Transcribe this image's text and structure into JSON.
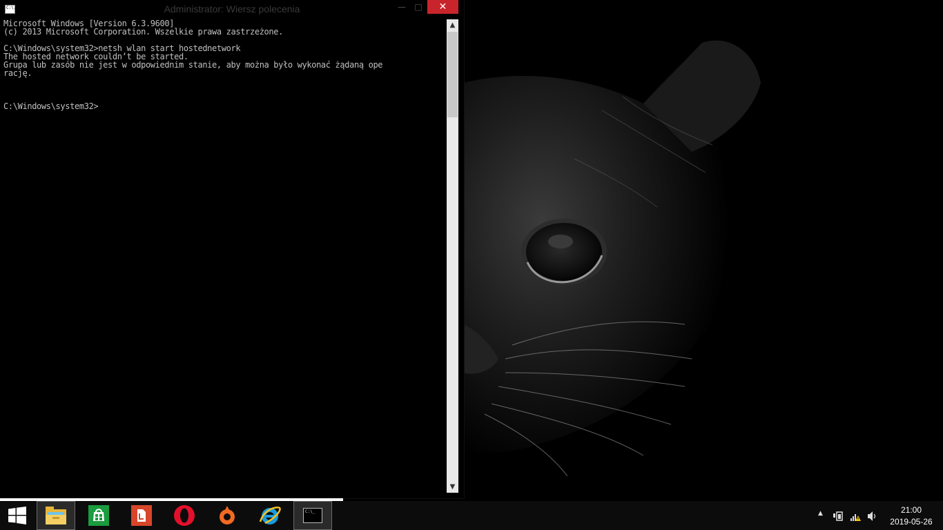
{
  "window": {
    "title": "Administrator: Wiersz polecenia",
    "icon_label": "C:\\.",
    "minimize_glyph": "—",
    "maximize_glyph": "□",
    "close_glyph": "✕"
  },
  "console": {
    "lines": [
      "Microsoft Windows [Version 6.3.9600]",
      "(c) 2013 Microsoft Corporation. Wszelkie prawa zastrzeżone.",
      "",
      "C:\\Windows\\system32>netsh wlan start hostednetwork",
      "The hosted network couldn’t be started.",
      "Grupa lub zasób nie jest w odpowiednim stanie, aby można było wykonać żądaną ope",
      "rację.",
      "",
      "",
      "",
      "C:\\Windows\\system32>"
    ]
  },
  "scrollbar": {
    "up_glyph": "▲",
    "down_glyph": "▼"
  },
  "taskbar": {
    "start_icon": "windows-logo-icon",
    "apps": [
      {
        "name": "file-explorer-icon",
        "active": false
      },
      {
        "name": "store-icon",
        "active": false
      },
      {
        "name": "acrobat-icon",
        "active": false
      },
      {
        "name": "opera-icon",
        "active": false
      },
      {
        "name": "origin-icon",
        "active": false
      },
      {
        "name": "internet-explorer-icon",
        "active": false
      },
      {
        "name": "command-prompt-icon",
        "active": true
      }
    ],
    "cmd_icon_label": "C:\\_",
    "tray": {
      "overflow_glyph": "▲",
      "time": "21:00",
      "date": "2019-05-26"
    }
  },
  "colors": {
    "console_text": "#c0c0c0",
    "close_button": "#c7252b",
    "taskbar": "#0c0c0c"
  }
}
